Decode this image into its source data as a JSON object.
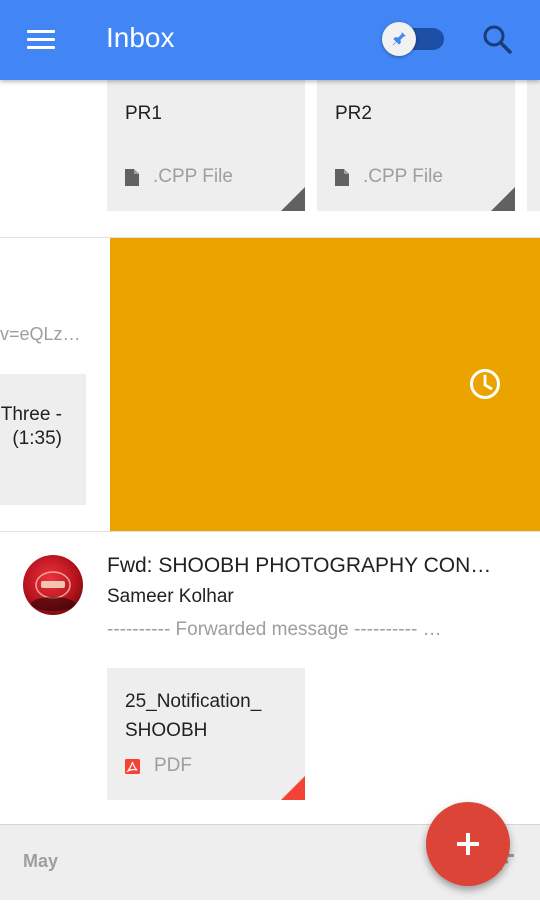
{
  "appbar": {
    "title": "Inbox",
    "color": "#4285f4",
    "menu_icon": "menu-icon",
    "pin_icon": "pin-icon",
    "search_icon": "search-icon",
    "pin_toggle_on": true
  },
  "top_bundle": {
    "attachments": [
      {
        "name": "PR1",
        "type": ".CPP File",
        "icon": "file-icon"
      },
      {
        "name": "PR2",
        "type": ".CPP File",
        "icon": "file-icon"
      }
    ]
  },
  "swiped_item": {
    "snippet": "v=eQLz…",
    "attachment_lines": [
      "Three -",
      "(1:35)"
    ],
    "snooze_color": "#eba300",
    "snooze_icon": "clock-icon"
  },
  "email": {
    "subject": "Fwd: SHOOBH PHOTOGRAPHY CON…",
    "sender": "Sameer Kolhar",
    "snippet": "---------- Forwarded message ---------- …",
    "attachment": {
      "name": "25_Notification_\nSHOOBH",
      "type": "PDF",
      "icon": "pdf-icon"
    }
  },
  "section": {
    "label": "May",
    "sort_icon": "sort-icon"
  },
  "fab": {
    "icon": "add-icon",
    "color": "#db4437"
  }
}
